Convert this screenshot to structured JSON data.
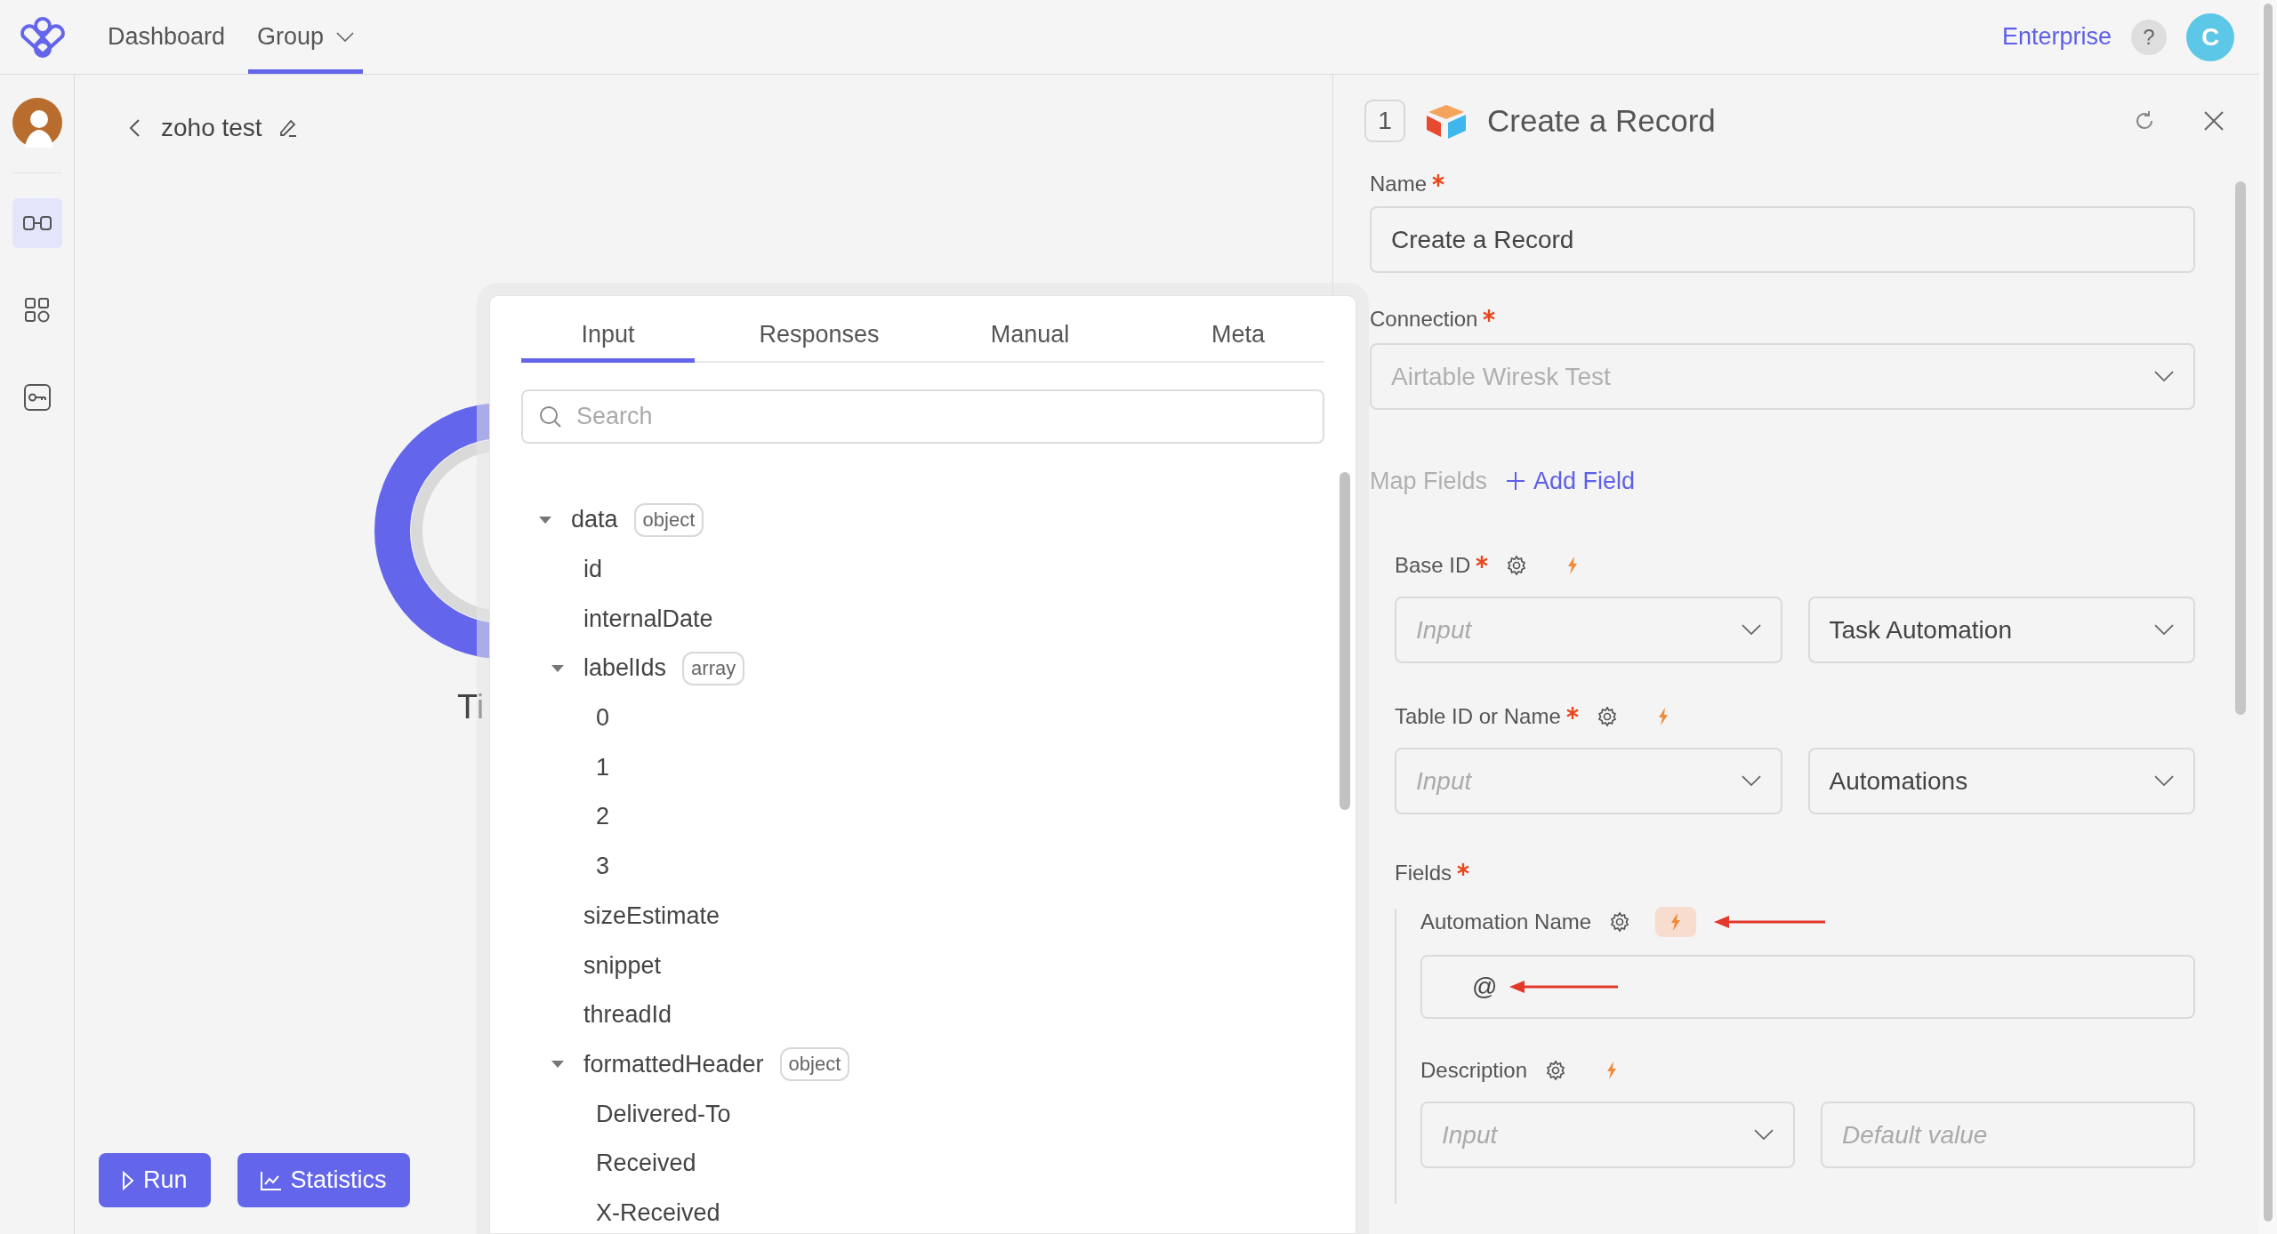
{
  "topbar": {
    "nav": [
      {
        "label": "Dashboard",
        "selected": false,
        "dropdown": false
      },
      {
        "label": "Group",
        "selected": true,
        "dropdown": true
      }
    ],
    "plan_link": "Enterprise",
    "help": "?",
    "avatar": "C"
  },
  "sidebar": {
    "items": [
      {
        "kind": "connector",
        "selected": true
      },
      {
        "kind": "grid",
        "selected": false
      },
      {
        "kind": "key",
        "selected": false
      }
    ]
  },
  "canvas": {
    "title": "zoho test",
    "node_label": "Ti",
    "buttons": [
      {
        "kind": "run",
        "label": "Run"
      },
      {
        "kind": "stats",
        "label": "Statistics"
      }
    ]
  },
  "popup": {
    "tabs": [
      {
        "label": "Input",
        "selected": true
      },
      {
        "label": "Responses",
        "selected": false
      },
      {
        "label": "Manual",
        "selected": false
      },
      {
        "label": "Meta",
        "selected": false
      }
    ],
    "search": {
      "placeholder": "Search"
    },
    "tree": [
      {
        "name": "data",
        "type": "object",
        "expanded": true,
        "children": [
          {
            "name": "id"
          },
          {
            "name": "internalDate"
          },
          {
            "name": "labelIds",
            "type": "array",
            "expanded": true,
            "children": [
              {
                "name": "0"
              },
              {
                "name": "1"
              },
              {
                "name": "2"
              },
              {
                "name": "3"
              }
            ]
          },
          {
            "name": "sizeEstimate"
          },
          {
            "name": "snippet"
          },
          {
            "name": "threadId"
          },
          {
            "name": "formattedHeader",
            "type": "object",
            "expanded": true,
            "children": [
              {
                "name": "Delivered-To"
              },
              {
                "name": "Received"
              },
              {
                "name": "X-Received"
              }
            ]
          }
        ]
      }
    ]
  },
  "panel": {
    "step": "1",
    "title": "Create a Record",
    "name": {
      "label": "Name",
      "required": true,
      "value": "Create a Record"
    },
    "connection": {
      "label": "Connection",
      "required": true,
      "value": "Airtable Wiresk Test",
      "disabled": true
    },
    "map_fields": "Map Fields",
    "add_field": "Add Field",
    "params": [
      {
        "label": "Base ID",
        "required": true,
        "highlighted": false,
        "source": {
          "placeholder": "Input"
        },
        "value": "Task Automation"
      },
      {
        "label": "Table ID or Name",
        "required": true,
        "highlighted": false,
        "source": {
          "placeholder": "Input"
        },
        "value": "Automations"
      }
    ],
    "fields": {
      "label": "Fields",
      "required": true,
      "items": [
        {
          "kind": "text",
          "label": "Automation Name",
          "highlighted": true,
          "annotated": true,
          "value": "@"
        },
        {
          "kind": "select_default",
          "label": "Description",
          "highlighted": false,
          "annotated": false,
          "source": {
            "placeholder": "Input"
          },
          "default": {
            "placeholder": "Default value"
          }
        }
      ]
    }
  }
}
